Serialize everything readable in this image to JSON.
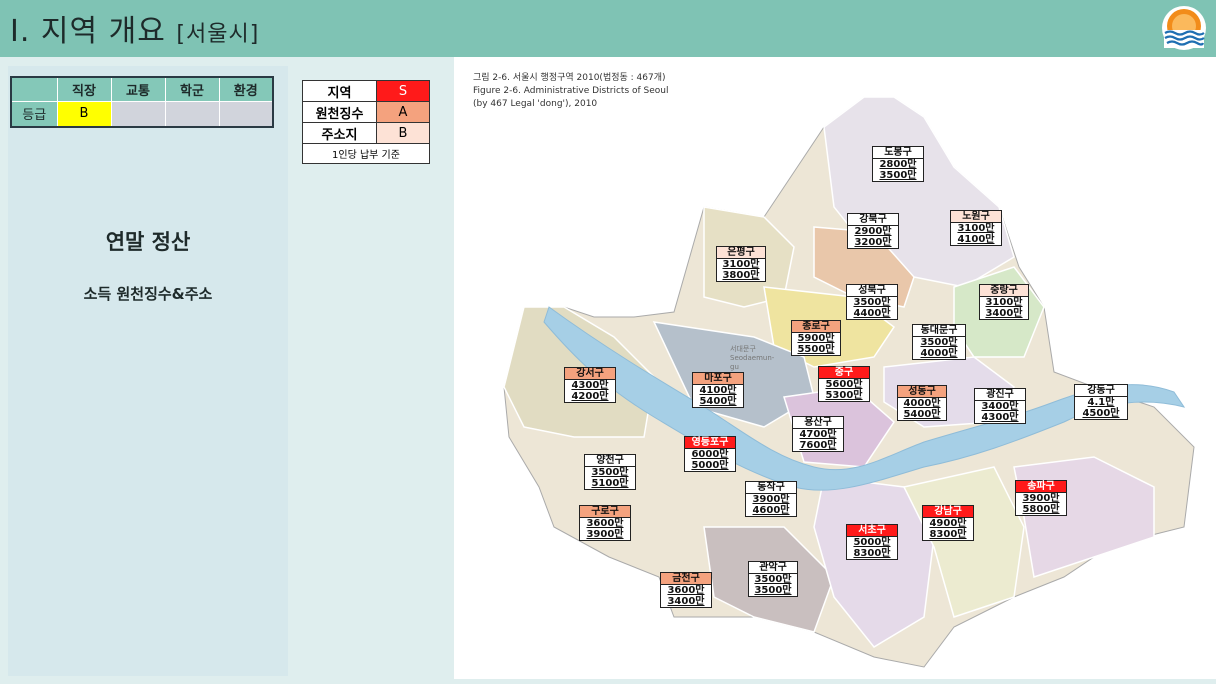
{
  "header": {
    "title": "I. 지역 개요",
    "subtitle": "[서울시]",
    "colors": {
      "bar": "#7fc3b4",
      "logo_orange": "#f28c1a",
      "logo_blue": "#1f6fb2"
    }
  },
  "grade_table": {
    "columns": [
      "직장",
      "교통",
      "학군",
      "환경"
    ],
    "row_label": "등급",
    "values": [
      "B",
      "",
      "",
      ""
    ]
  },
  "panel": {
    "heading": "연말 정산",
    "subheading": "소득 원천징수&주소"
  },
  "legend": {
    "rows": [
      {
        "label": "지역",
        "grade": "S",
        "color": "#ff1a1a"
      },
      {
        "label": "원천징수",
        "grade": "A",
        "color": "#f4a27e"
      },
      {
        "label": "주소지",
        "grade": "B",
        "color": "#fde2d6"
      }
    ],
    "note": "1인당 납부 기준"
  },
  "map": {
    "caption_lines": [
      "그림 2-6. 서울시 행정구역 2010(법정동 : 467개)",
      "Figure 2-6. Administrative Districts of Seoul",
      "(by 467 Legal 'dong'), 2010"
    ],
    "inline_label": "서대문구 Seodaemun-gu",
    "districts": [
      {
        "name": "도봉구",
        "v1": "2800만",
        "v2": "3500만",
        "grade": "none"
      },
      {
        "name": "노원구",
        "v1": "3100만",
        "v2": "4100만",
        "grade": "B"
      },
      {
        "name": "강북구",
        "v1": "2900만",
        "v2": "3200만",
        "grade": "none"
      },
      {
        "name": "은평구",
        "v1": "3100만",
        "v2": "3800만",
        "grade": "B"
      },
      {
        "name": "성북구",
        "v1": "3500만",
        "v2": "4400만",
        "grade": "none"
      },
      {
        "name": "중랑구",
        "v1": "3100만",
        "v2": "3400만",
        "grade": "B"
      },
      {
        "name": "종로구",
        "v1": "5900만",
        "v2": "5500만",
        "grade": "A"
      },
      {
        "name": "동대문구",
        "v1": "3500만",
        "v2": "4000만",
        "grade": "none"
      },
      {
        "name": "강서구",
        "v1": "4300만",
        "v2": "4200만",
        "grade": "A"
      },
      {
        "name": "마포구",
        "v1": "4100만",
        "v2": "5400만",
        "grade": "A"
      },
      {
        "name": "중구",
        "v1": "5600만",
        "v2": "5300만",
        "grade": "S"
      },
      {
        "name": "성동구",
        "v1": "4000만",
        "v2": "5400만",
        "grade": "A"
      },
      {
        "name": "광진구",
        "v1": "3400만",
        "v2": "4300만",
        "grade": "none"
      },
      {
        "name": "강동구",
        "v1": "4.1만",
        "v2": "4500만",
        "grade": "none"
      },
      {
        "name": "용산구",
        "v1": "4700만",
        "v2": "7600만",
        "grade": "none"
      },
      {
        "name": "영등포구",
        "v1": "6000만",
        "v2": "5000만",
        "grade": "S"
      },
      {
        "name": "양천구",
        "v1": "3500만",
        "v2": "5100만",
        "grade": "none"
      },
      {
        "name": "동작구",
        "v1": "3900만",
        "v2": "4600만",
        "grade": "none"
      },
      {
        "name": "송파구",
        "v1": "3900만",
        "v2": "5800만",
        "grade": "S"
      },
      {
        "name": "구로구",
        "v1": "3600만",
        "v2": "3900만",
        "grade": "A"
      },
      {
        "name": "강남구",
        "v1": "4900만",
        "v2": "8300만",
        "grade": "S"
      },
      {
        "name": "서초구",
        "v1": "5000만",
        "v2": "8300만",
        "grade": "S"
      },
      {
        "name": "관악구",
        "v1": "3500만",
        "v2": "3500만",
        "grade": "none"
      },
      {
        "name": "금천구",
        "v1": "3600만",
        "v2": "3400만",
        "grade": "A"
      }
    ]
  }
}
